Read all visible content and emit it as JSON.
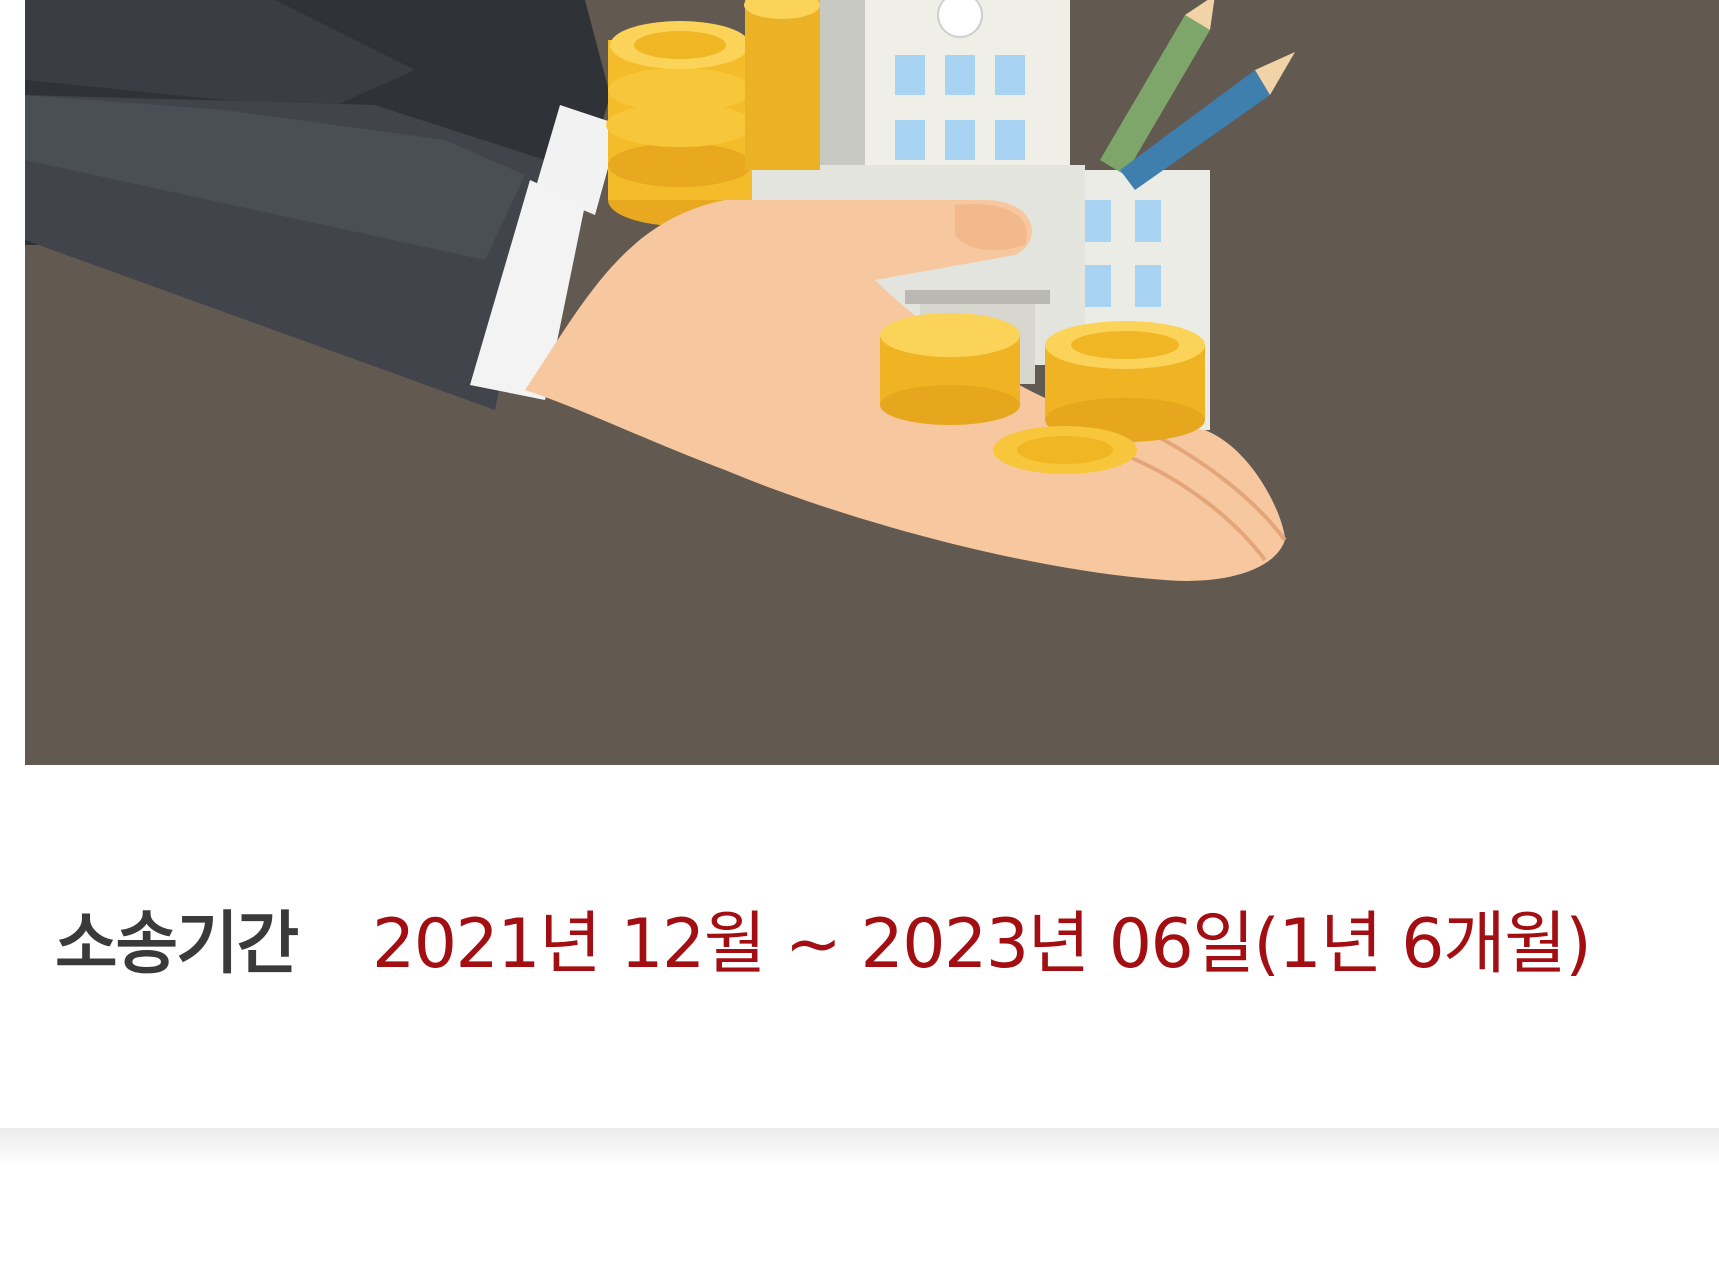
{
  "illustration": {
    "icon": "hands-with-coins-and-building-illustration",
    "background_color": "#625950"
  },
  "period": {
    "label": "소송기간",
    "value": "2021년 12월 ~ 2023년 06일(1년 6개월)",
    "label_color": "#3a3a3a",
    "value_color": "#a30e12"
  }
}
